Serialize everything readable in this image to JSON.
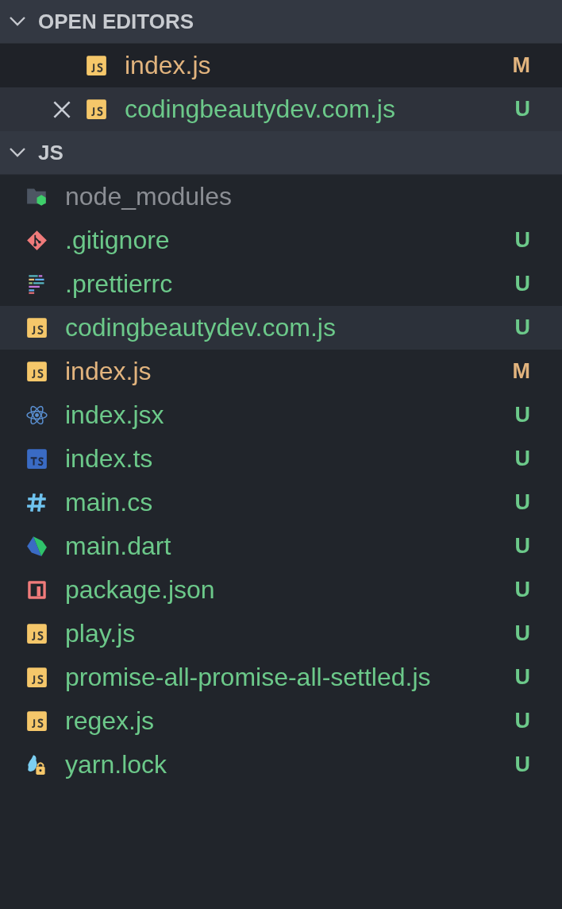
{
  "sections": [
    {
      "title": "OPEN EDITORS",
      "expanded": true,
      "kind": "editors",
      "items": [
        {
          "name": "index.js",
          "kind": "js",
          "color": "#e2b47e",
          "status": "M",
          "selected": false,
          "close_shown": false
        },
        {
          "name": "codingbeautydev.com.js",
          "kind": "js",
          "color": "#6cc98a",
          "status": "U",
          "selected": true,
          "close_shown": true
        }
      ]
    },
    {
      "title": "JS",
      "expanded": true,
      "kind": "files",
      "items": [
        {
          "name": "node_modules",
          "kind": "folder-node",
          "color": "#8b8e94",
          "selected": false
        },
        {
          "name": ".gitignore",
          "kind": "git",
          "color": "#6cc98a",
          "status": "U",
          "selected": false
        },
        {
          "name": ".prettierrc",
          "kind": "prettier",
          "color": "#6cc98a",
          "status": "U",
          "selected": false
        },
        {
          "name": "codingbeautydev.com.js",
          "kind": "js",
          "color": "#6cc98a",
          "status": "U",
          "selected": true
        },
        {
          "name": "index.js",
          "kind": "js",
          "color": "#e2b47e",
          "status": "M",
          "selected": false
        },
        {
          "name": "index.jsx",
          "kind": "react",
          "color": "#6cc98a",
          "status": "U",
          "selected": false
        },
        {
          "name": "index.ts",
          "kind": "ts",
          "color": "#6cc98a",
          "status": "U",
          "selected": false
        },
        {
          "name": "main.cs",
          "kind": "csharp",
          "color": "#6cc98a",
          "status": "U",
          "selected": false
        },
        {
          "name": "main.dart",
          "kind": "dart",
          "color": "#6cc98a",
          "status": "U",
          "selected": false
        },
        {
          "name": "package.json",
          "kind": "npm",
          "color": "#6cc98a",
          "status": "U",
          "selected": false
        },
        {
          "name": "play.js",
          "kind": "js",
          "color": "#6cc98a",
          "status": "U",
          "selected": false
        },
        {
          "name": "promise-all-promise-all-settled.js",
          "kind": "js",
          "color": "#6cc98a",
          "status": "U",
          "selected": false
        },
        {
          "name": "regex.js",
          "kind": "js",
          "color": "#6cc98a",
          "status": "U",
          "selected": false
        },
        {
          "name": "yarn.lock",
          "kind": "yarn",
          "color": "#6cc98a",
          "status": "U",
          "selected": false
        }
      ]
    }
  ]
}
